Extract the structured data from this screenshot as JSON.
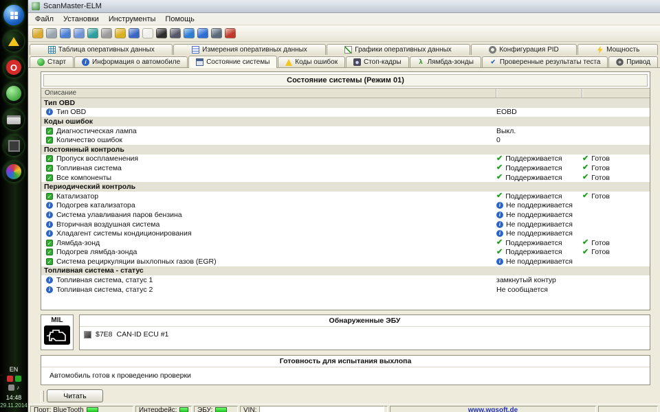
{
  "taskbar": {
    "lang": "EN",
    "time": "14:48",
    "date": "29.11.2014"
  },
  "window": {
    "title": "ScanMaster-ELM",
    "menu": [
      "Файл",
      "Установки",
      "Инструменты",
      "Помощь"
    ]
  },
  "toolbar": {
    "icons": [
      "connect",
      "search",
      "report",
      "document",
      "table",
      "calculator",
      "currency",
      "books",
      "chat",
      "battery",
      "camera",
      "globe",
      "info",
      "monitor",
      "exit"
    ]
  },
  "tabs_row1": [
    {
      "label": "Таблица оперативных данных",
      "icon": "table"
    },
    {
      "label": "Измерения оперативных данных",
      "icon": "gauge"
    },
    {
      "label": "Графики оперативных данных",
      "icon": "chart"
    },
    {
      "label": "Конфигурация PID",
      "icon": "config"
    },
    {
      "label": "Мощность",
      "icon": "power"
    }
  ],
  "tabs_row2": [
    {
      "label": "Старт",
      "icon": "start"
    },
    {
      "label": "Информация о автомобиле",
      "icon": "carinfo"
    },
    {
      "label": "Состояние системы",
      "icon": "system",
      "active": true
    },
    {
      "label": "Коды ошибок",
      "icon": "dtc"
    },
    {
      "label": "Стоп-кадры",
      "icon": "camera"
    },
    {
      "label": "Лямбда-зонды",
      "icon": "lambda"
    },
    {
      "label": "Проверенные результаты теста",
      "icon": "results"
    },
    {
      "label": "Привод",
      "icon": "actuator"
    }
  ],
  "main": {
    "title": "Состояние системы (Режим 01)",
    "col_header": "Описание",
    "rows": [
      {
        "t": "section",
        "label": "Тип OBD"
      },
      {
        "t": "item",
        "icon": "info",
        "label": "Тип OBD",
        "v1": {
          "text": "EOBD"
        }
      },
      {
        "t": "section",
        "label": "Коды ошибок"
      },
      {
        "t": "item",
        "icon": "check",
        "label": "Диагностическая лампа",
        "v1": {
          "text": "Выкл."
        }
      },
      {
        "t": "item",
        "icon": "check",
        "label": "Количество ошибок",
        "v1": {
          "text": "0"
        }
      },
      {
        "t": "section",
        "label": "Постоянный контроль"
      },
      {
        "t": "item",
        "icon": "check",
        "label": "Пропуск воспламенения",
        "v1": {
          "icon": "check",
          "text": "Поддерживается"
        },
        "v2": {
          "icon": "check",
          "text": "Готов"
        }
      },
      {
        "t": "item",
        "icon": "check",
        "label": "Топливная система",
        "v1": {
          "icon": "check",
          "text": "Поддерживается"
        },
        "v2": {
          "icon": "check",
          "text": "Готов"
        }
      },
      {
        "t": "item",
        "icon": "check",
        "label": "Все компоненты",
        "v1": {
          "icon": "check",
          "text": "Поддерживается"
        },
        "v2": {
          "icon": "check",
          "text": "Готов"
        }
      },
      {
        "t": "section",
        "label": "Периодический контроль"
      },
      {
        "t": "item",
        "icon": "check",
        "label": "Катализатор",
        "v1": {
          "icon": "check",
          "text": "Поддерживается"
        },
        "v2": {
          "icon": "check",
          "text": "Готов"
        }
      },
      {
        "t": "item",
        "icon": "info",
        "label": "Подогрев катализатора",
        "v1": {
          "icon": "info",
          "text": "Не поддерживается"
        }
      },
      {
        "t": "item",
        "icon": "info",
        "label": "Система улавливания паров бензина",
        "v1": {
          "icon": "info",
          "text": "Не поддерживается"
        }
      },
      {
        "t": "item",
        "icon": "info",
        "label": "Вторичная воздушная система",
        "v1": {
          "icon": "info",
          "text": "Не поддерживается"
        }
      },
      {
        "t": "item",
        "icon": "info",
        "label": "Хладагент системы кондиционирования",
        "v1": {
          "icon": "info",
          "text": "Не поддерживается"
        }
      },
      {
        "t": "item",
        "icon": "check",
        "label": "Лямбда-зонд",
        "v1": {
          "icon": "check",
          "text": "Поддерживается"
        },
        "v2": {
          "icon": "check",
          "text": "Готов"
        }
      },
      {
        "t": "item",
        "icon": "check",
        "label": "Подогрев лямбда-зонда",
        "v1": {
          "icon": "check",
          "text": "Поддерживается"
        },
        "v2": {
          "icon": "check",
          "text": "Готов"
        }
      },
      {
        "t": "item",
        "icon": "check",
        "label": "Система рециркуляции выхлопных газов (EGR)",
        "v1": {
          "icon": "info",
          "text": "Не поддерживается"
        }
      },
      {
        "t": "section",
        "label": "Топливная система - статус"
      },
      {
        "t": "item",
        "icon": "info",
        "label": "Топливная система, статус 1",
        "v1": {
          "text": "замкнутый контур"
        }
      },
      {
        "t": "item",
        "icon": "info",
        "label": "Топливная система, статус 2",
        "v1": {
          "text": "Не сообщается"
        }
      }
    ]
  },
  "mil": {
    "label": "MIL"
  },
  "ecu": {
    "title": "Обнаруженные ЭБУ",
    "id": "$7E8",
    "name": "CAN-ID ECU #1"
  },
  "readiness": {
    "title": "Готовность для испытания выхлопа",
    "text": "Автомобиль готов к проведению проверки"
  },
  "actions": {
    "read": "Читать"
  },
  "statusbar": {
    "port": "Порт: BlueTooth",
    "interface": "Интерфейс:",
    "ecu": "ЭБУ:",
    "vin": "VIN:",
    "website": "www.wgsoft.de"
  },
  "colors": {
    "led_green": "#22dd22",
    "link_blue": "#2233bb",
    "check_green": "#1fa11f",
    "info_blue": "#2b63c6"
  }
}
